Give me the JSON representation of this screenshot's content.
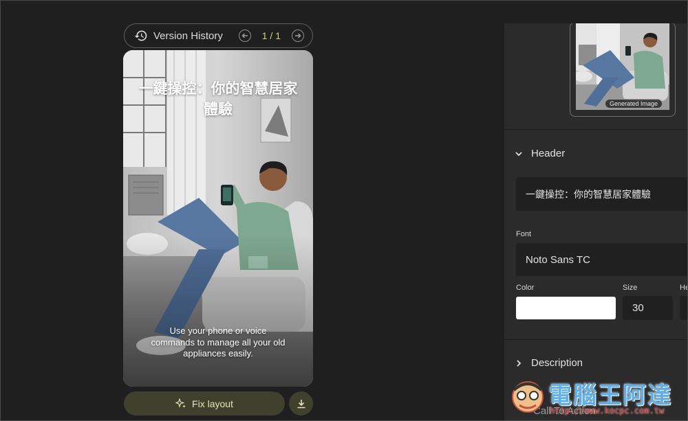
{
  "version_history": {
    "title": "Version History",
    "counter": "1 / 1"
  },
  "preview": {
    "headline": "一鍵操控：你的智慧居家體驗",
    "description": "Use your phone or voice commands to manage all your old appliances easily."
  },
  "actions": {
    "fix_layout": "Fix layout"
  },
  "panel": {
    "thumbnail_badge": "Generated Image",
    "header_section": {
      "label": "Header",
      "text_value": "一鍵操控：你的智慧居家體驗",
      "font_label": "Font",
      "font_value": "Noto Sans TC",
      "color_label": "Color",
      "color_value": "#ffffff",
      "size_label": "Size",
      "size_value": "30",
      "cut_label": "He"
    },
    "description_section": {
      "label": "Description"
    },
    "cta_section": {
      "label": "Call To Action"
    }
  },
  "watermark": {
    "text": "電腦王阿達",
    "url": "http://www.kocpc.com.tw"
  },
  "colors": {
    "accent_yellow": "#d8d07a",
    "button_bg": "#3f412d",
    "panel_bg": "#2b2b2b",
    "page_bg": "#1f1f1f"
  },
  "icons": [
    "history-icon",
    "prev-circle-icon",
    "next-circle-icon",
    "sparkle-icon",
    "download-icon",
    "chevron-down-icon",
    "chevron-right-icon"
  ]
}
